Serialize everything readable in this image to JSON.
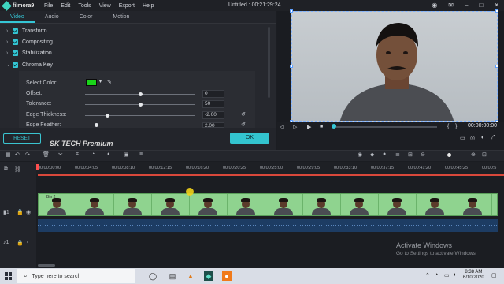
{
  "app": {
    "logo_text": "filmora9",
    "menu": [
      "File",
      "Edit",
      "Tools",
      "View",
      "Export",
      "Help"
    ],
    "title": "Untitled : 00:21:29:24"
  },
  "tabs": [
    "Video",
    "Audio",
    "Color",
    "Motion"
  ],
  "sections": [
    "Transform",
    "Compositing",
    "Stabilization",
    "Chroma Key"
  ],
  "chroma_key": {
    "select_color_label": "Select Color:",
    "swatch_color": "#1ad41a",
    "offset": {
      "label": "Offset:",
      "value": "0",
      "level": 0.5
    },
    "tolerance": {
      "label": "Tolerance:",
      "value": "50",
      "level": 0.5
    },
    "edge_thickness": {
      "label": "Edge Thickness:",
      "value": "-2.00",
      "level": 0.2
    },
    "edge_feather": {
      "label": "Edge Feather:",
      "value": "2.00",
      "level": 0.1
    }
  },
  "buttons": {
    "reset": "RESET",
    "ok": "OK"
  },
  "overlay_text": "SK TECH Premium",
  "preview": {
    "timecode": "00:00:00:00"
  },
  "timeline": {
    "ticks": [
      "00:00:00:00",
      "00:00:04:05",
      "00:00:08:10",
      "00:00:12:15",
      "00:00:16:20",
      "00:00:20:25",
      "00:00:25:00",
      "00:00:29:05",
      "00:00:33:10",
      "00:00:37:15",
      "00:00:41:20",
      "00:00:45:25",
      "00:00:5"
    ],
    "clip_label": "Bin 2"
  },
  "watermark": {
    "line1": "Activate Windows",
    "line2": "Go to Settings to activate Windows."
  },
  "taskbar": {
    "search_placeholder": "Type here to search",
    "time": "8:38 AM",
    "date": "6/10/2020"
  },
  "colors": {
    "accent": "#35c6d6",
    "playhead": "#ff4e4e",
    "video_clip": "#8fd38f",
    "audio_clip": "#1d3c63"
  }
}
